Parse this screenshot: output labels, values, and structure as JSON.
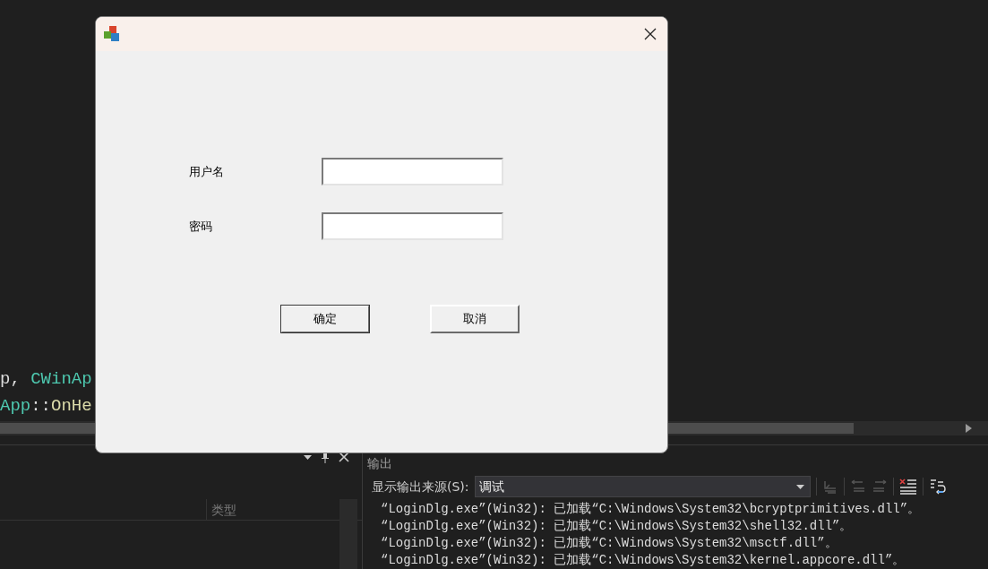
{
  "editor": {
    "code_lines": [
      {
        "tokens": [
          {
            "text": "p, ",
            "kind": "plain"
          },
          {
            "text": "CWinAp",
            "kind": "type"
          }
        ]
      },
      {
        "tokens": [
          {
            "text": "App",
            "kind": "type"
          },
          {
            "text": "::",
            "kind": "plain"
          },
          {
            "text": "OnHe",
            "kind": "function"
          }
        ]
      }
    ]
  },
  "left_panel": {
    "columns": [
      "类型"
    ]
  },
  "output_panel": {
    "title": "输出",
    "source_label": "显示输出来源(S):",
    "source_value": "调试",
    "lines": [
      "“LoginDlg.exe”(Win32): 已加载“C:\\Windows\\System32\\bcryptprimitives.dll”。",
      "“LoginDlg.exe”(Win32): 已加载“C:\\Windows\\System32\\shell32.dll”。",
      "“LoginDlg.exe”(Win32): 已加载“C:\\Windows\\System32\\msctf.dll”。",
      "“LoginDlg.exe”(Win32): 已加载“C:\\Windows\\System32\\kernel.appcore.dll”。"
    ]
  },
  "dialog": {
    "fields": [
      {
        "label": "用户名"
      },
      {
        "label": "密码"
      }
    ],
    "buttons": [
      {
        "label": "确定",
        "default": true
      },
      {
        "label": "取消",
        "default": false
      }
    ]
  }
}
